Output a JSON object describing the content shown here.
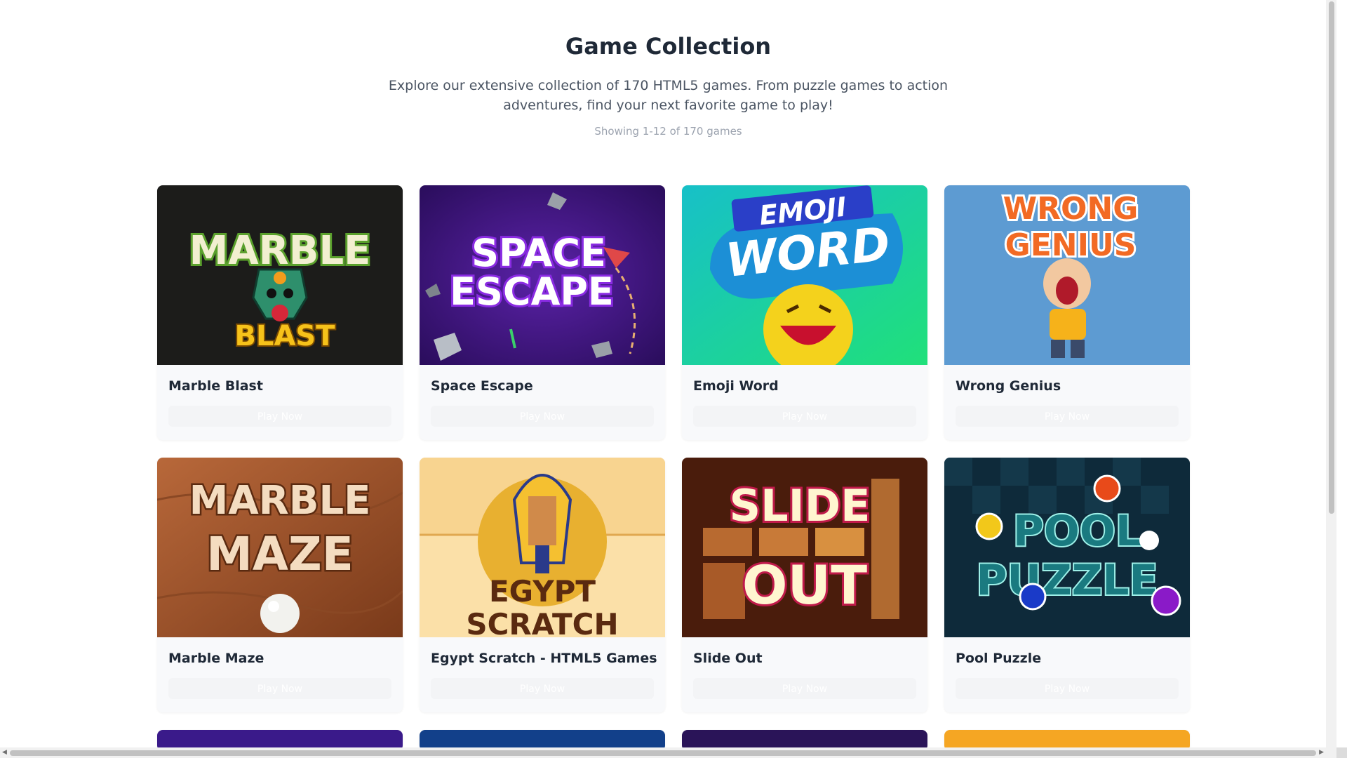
{
  "header": {
    "title": "Game Collection",
    "subtitle": "Explore our extensive collection of 170 HTML5 games. From puzzle games to action adventures, find your next favorite game to play!",
    "count": "Showing 1-12 of 170 games"
  },
  "play_label": "Play Now",
  "games": [
    {
      "title": "Marble Blast",
      "art_line1": "MARBLE",
      "art_line2": "BLAST"
    },
    {
      "title": "Space Escape",
      "art_line1": "SPACE",
      "art_line2": "ESCAPE"
    },
    {
      "title": "Emoji Word",
      "art_line1": "EMOJI",
      "art_line2": "WORD"
    },
    {
      "title": "Wrong Genius",
      "art_line1": "WRONG",
      "art_line2": "GENIUS"
    },
    {
      "title": "Marble Maze",
      "art_line1": "MARBLE",
      "art_line2": "MAZE"
    },
    {
      "title": "Egypt Scratch - HTML5 Games",
      "art_line1": "EGYPT",
      "art_line2": "SCRATCH"
    },
    {
      "title": "Slide Out",
      "art_line1": "SLIDE",
      "art_line2": "OUT"
    },
    {
      "title": "Pool Puzzle",
      "art_line1": "POOL",
      "art_line2": "PUZZLE"
    }
  ],
  "colors": {
    "marble_blast_bg": "#1c1c1a",
    "space_escape_bg": "#3a1473",
    "emoji_word_bg": "#1bc8b4",
    "wrong_genius_bg": "#5d9bd2",
    "marble_maze_bg": "#a0542a",
    "egypt_scratch_bg": "#fbe0a8",
    "slide_out_bg": "#4a1c0c",
    "pool_puzzle_bg": "#0e2a3a",
    "row3_1": "#3a1a8a",
    "row3_2": "#12408a",
    "row3_3": "#2a1458",
    "row3_4": "#f5a623"
  }
}
